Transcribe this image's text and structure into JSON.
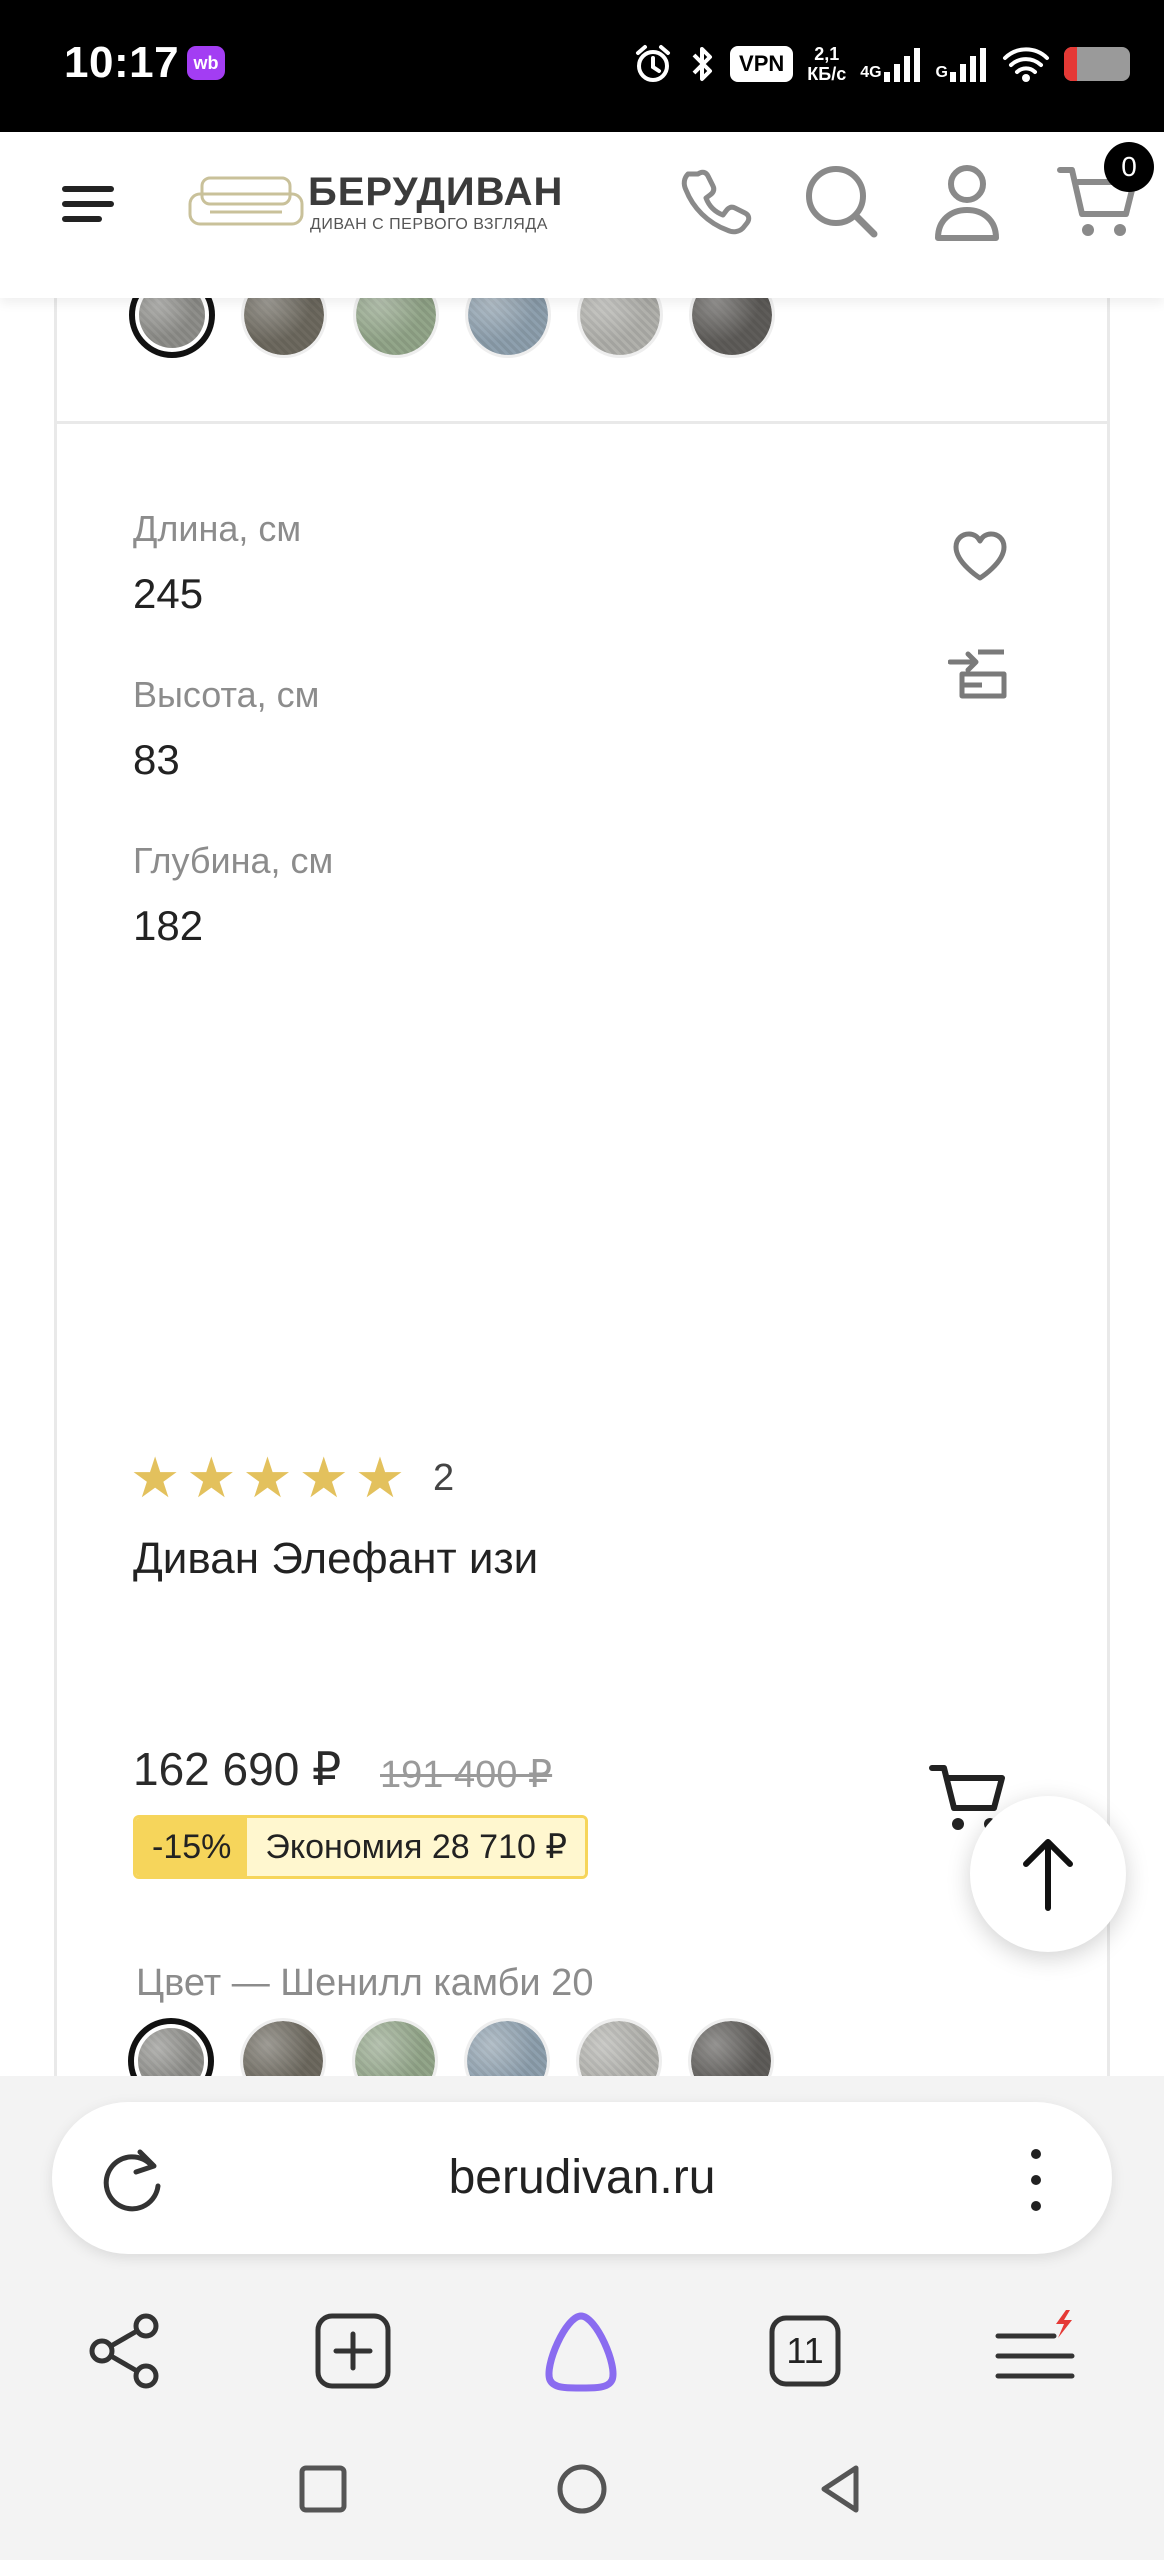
{
  "status_bar": {
    "time": "10:17",
    "app_badge": "wb",
    "vpn": "VPN",
    "speed_value": "2,1",
    "speed_unit": "КБ/с",
    "net_1": "4G",
    "net_2": "G",
    "battery_level": 0.2
  },
  "header": {
    "logo_title": "БЕРУДИВАН",
    "logo_subtitle": "ДИВАН С ПЕРВОГО ВЗГЛЯДА",
    "cart_count": "0",
    "icons": [
      "menu-icon",
      "phone-icon",
      "search-icon",
      "user-icon",
      "cart-icon"
    ]
  },
  "specs": [
    {
      "label": "Длина, см",
      "value": "245"
    },
    {
      "label": "Высота, см",
      "value": "83"
    },
    {
      "label": "Глубина, см",
      "value": "182"
    }
  ],
  "product": {
    "rating_stars": 5,
    "review_count": "2",
    "title": "Диван Элефант изи",
    "price": "162 690 ₽",
    "old_price": "191 400 ₽",
    "discount_percent": "-15%",
    "savings": "Экономия 28 710 ₽",
    "color_label": "Цвет  —  Шенилл камби 20",
    "swatch_colors": [
      "#8f8f8b",
      "#6e6a60",
      "#93a68a",
      "#8ea0ae",
      "#b1b1ac",
      "#5f5d5a"
    ]
  },
  "browser": {
    "url": "berudivan.ru",
    "tabs_count": "11"
  }
}
